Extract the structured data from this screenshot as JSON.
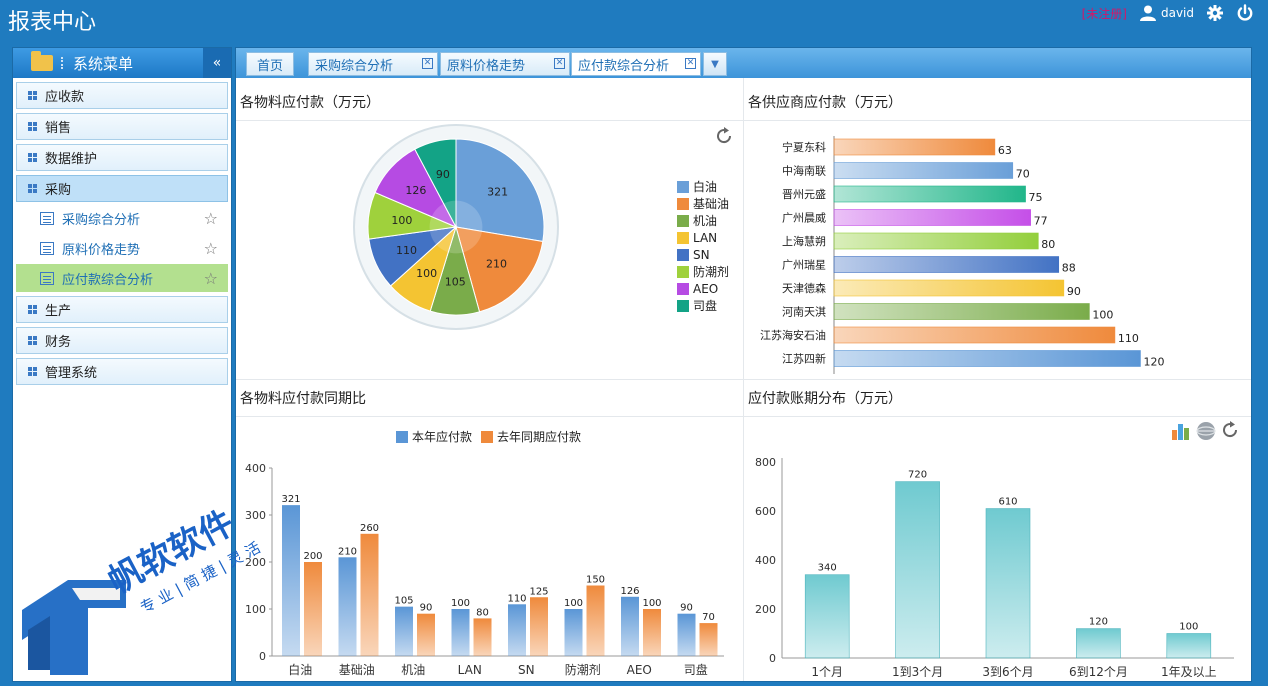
{
  "header": {
    "title": "报表中心",
    "link": "[未注册]",
    "user": "david"
  },
  "sidebar": {
    "title": "系统菜单",
    "collapse_glyph": "«",
    "categories": [
      {
        "label": "应收款"
      },
      {
        "label": "销售"
      },
      {
        "label": "数据维护"
      },
      {
        "label": "采购"
      },
      {
        "label": "生产"
      },
      {
        "label": "财务"
      },
      {
        "label": "管理系统"
      }
    ],
    "sub_items": [
      {
        "label": "采购综合分析"
      },
      {
        "label": "原料价格走势"
      },
      {
        "label": "应付款综合分析"
      }
    ]
  },
  "tabs": [
    {
      "label": "首页"
    },
    {
      "label": "采购综合分析"
    },
    {
      "label": "原料价格走势"
    },
    {
      "label": "应付款综合分析"
    }
  ],
  "watermark": {
    "brand": "帆软软件",
    "slogan": "专 业 | 简 捷 | 灵 活"
  },
  "colors": {
    "accent": "#1f7bbf",
    "pie": [
      "#6a9fd8",
      "#ef8a3c",
      "#7aac4a",
      "#f4c432",
      "#4272c4",
      "#9fd13c",
      "#b64be3",
      "#13a386"
    ],
    "this_year": "#5a96d6",
    "last_year": "#ef8a3c",
    "aging": "#6fcad0"
  },
  "chart_data": [
    {
      "id": "pie",
      "type": "pie",
      "title": "各物料应付款（万元）",
      "categories": [
        "白油",
        "基础油",
        "机油",
        "LAN",
        "SN",
        "防潮剂",
        "AEO",
        "司盘"
      ],
      "values": [
        321,
        210,
        105,
        100,
        110,
        100,
        126,
        90
      ],
      "legend": "right"
    },
    {
      "id": "supplier",
      "type": "bar",
      "title": "各供应商应付款（万元）",
      "categories": [
        "宁夏东科",
        "中海南联",
        "晋州元盛",
        "广州晨威",
        "上海慧朔",
        "广州瑞星",
        "天津德森",
        "河南天淇",
        "江苏海安石油",
        "江苏四新"
      ],
      "values": [
        63,
        70,
        75,
        77,
        80,
        88,
        90,
        100,
        110,
        120
      ],
      "bar_colors": [
        "#ef8a3c",
        "#6a9fd8",
        "#21b68a",
        "#c54fe8",
        "#93cf3c",
        "#4272c4",
        "#f4c432",
        "#7aac4a",
        "#ef8a3c",
        "#5a96d6"
      ],
      "orientation": "horizontal",
      "xlim": [
        0,
        130
      ]
    },
    {
      "id": "compare",
      "type": "bar",
      "title": "各物料应付款同期比",
      "categories": [
        "白油",
        "基础油",
        "机油",
        "LAN",
        "SN",
        "防潮剂",
        "AEO",
        "司盘"
      ],
      "series": [
        {
          "name": "本年应付款",
          "values": [
            321,
            210,
            105,
            100,
            110,
            100,
            126,
            90
          ]
        },
        {
          "name": "去年同期应付款",
          "values": [
            200,
            260,
            90,
            80,
            125,
            150,
            100,
            70
          ]
        }
      ],
      "yticks": [
        0,
        100,
        200,
        300,
        400
      ],
      "ylim": [
        0,
        400
      ],
      "legend": "top"
    },
    {
      "id": "aging",
      "type": "bar",
      "title": "应付款账期分布（万元）",
      "categories": [
        "1个月",
        "1到3个月",
        "3到6个月",
        "6到12个月",
        "1年及以上"
      ],
      "values": [
        340,
        720,
        610,
        120,
        100
      ],
      "yticks": [
        0,
        200,
        400,
        600,
        800
      ],
      "ylim": [
        0,
        800
      ]
    }
  ]
}
